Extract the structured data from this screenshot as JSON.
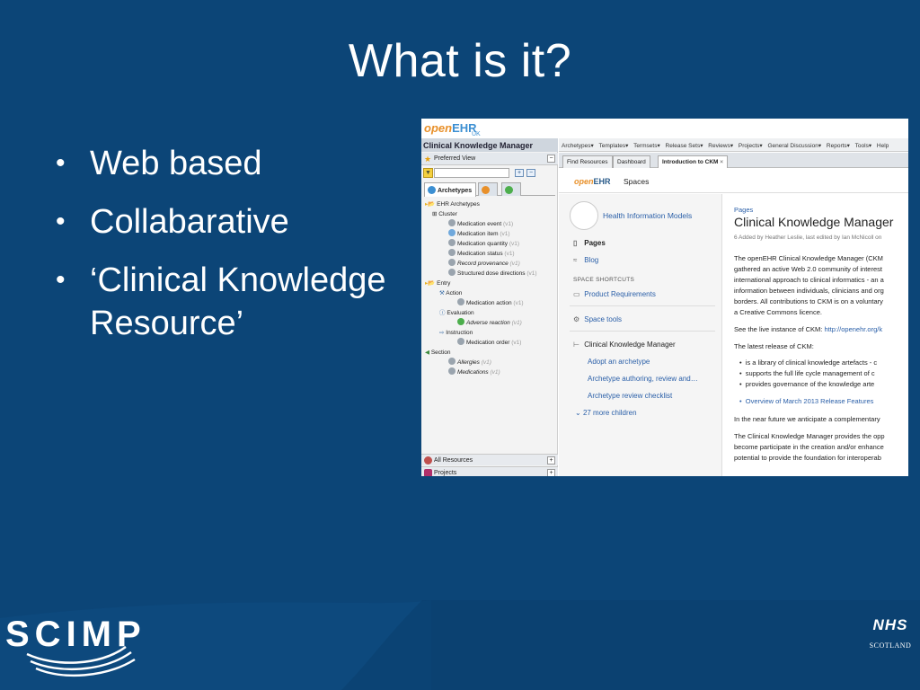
{
  "slide": {
    "title": "What is it?",
    "bullets": [
      "Web based",
      "Collabarative",
      "‘Clinical Knowledge",
      "Resource’"
    ],
    "bullet_glyph": "•"
  },
  "screenshot": {
    "logo": {
      "open": "open",
      "ehr": "EHR",
      "uk": "UK"
    },
    "left_panel": {
      "title": "Clinical Knowledge Manager",
      "preferred_view": "Preferred View",
      "tabs": [
        "Archetypes"
      ],
      "tree": {
        "root": "EHR Archetypes",
        "cluster": "Cluster",
        "cluster_items": [
          {
            "name": "Medication event",
            "ver": "(v1)",
            "italic": false
          },
          {
            "name": "Medication item",
            "ver": "(v1)",
            "italic": false
          },
          {
            "name": "Medication quantity",
            "ver": "(v1)",
            "italic": false
          },
          {
            "name": "Medication status",
            "ver": "(v1)",
            "italic": false
          },
          {
            "name": "Record provenance",
            "ver": "(v1)",
            "italic": true
          },
          {
            "name": "Structured dose directions",
            "ver": "(v1)",
            "italic": false
          }
        ],
        "entry": "Entry",
        "action": "Action",
        "medication_action": {
          "name": "Medication action",
          "ver": "(v1)"
        },
        "evaluation": "Evaluation",
        "adverse_reaction": {
          "name": "Adverse reaction",
          "ver": "(v1)"
        },
        "instruction": "Instruction",
        "medication_order": {
          "name": "Medication order",
          "ver": "(v1)"
        },
        "section": "Section",
        "allergies": {
          "name": "Allergies",
          "ver": "(v1)"
        },
        "medications": {
          "name": "Medications",
          "ver": "(v1)"
        }
      },
      "bottom": [
        "All Resources",
        "Projects"
      ]
    },
    "menubar": [
      "Archetypes▾",
      "Templates▾",
      "Termsets▾",
      "Release Sets▾",
      "Reviews▾",
      "Projects▾",
      "General Discussion▾",
      "Reports▾",
      "Tools▾",
      "Help"
    ],
    "tabs": [
      "Find Resources",
      "Dashboard",
      "Introduction to CKM"
    ],
    "tab_close": "×",
    "confluence": {
      "logo_open": "open",
      "logo_ehr": "EHR",
      "spaces": "Spaces",
      "space_name": "Health Information Models",
      "nav": [
        {
          "icon": "📄",
          "label": "Pages",
          "bold": true
        },
        {
          "icon": "⤨",
          "label": "Blog",
          "bold": false
        }
      ],
      "shortcuts_heading": "SPACE SHORTCUTS",
      "product_requirements": "Product Requirements",
      "space_tools": "Space tools",
      "tree_root": "Clinical Knowledge Manager",
      "children": [
        "Adopt an archetype",
        "Archetype authoring, review and…",
        "Archetype review checklist"
      ],
      "more_children": "27 more children",
      "breadcrumb": "Pages",
      "page_title": "Clinical Knowledge Manager",
      "meta": "6  Added by Heather Leslie, last edited by Ian McNicoll on",
      "paragraphs": [
        "The openEHR Clinical Knowledge Manager (CKM",
        "gathered an active Web 2.0 community of interest",
        "international approach to clinical informatics - an a",
        "information between individuals, clinicians and org",
        "borders. All contributions to CKM is on a voluntary",
        "a Creative Commons licence."
      ],
      "see_live": "See the live instance of CKM: ",
      "see_live_link": "http://openehr.org/k",
      "latest": "The latest release of CKM:",
      "list_items": [
        "is a library of clinical knowledge artefacts - c",
        "supports the full life cycle management of c",
        "provides governance of the knowledge arte"
      ],
      "overview_link": "Overview of March 2013 Release Features",
      "near_future": "In the near future we anticipate a complementary",
      "ckm_provides": [
        "The Clinical Knowledge Manager provides the opp",
        "become participate in the creation and/or enhance",
        "potential to provide the foundation for interoperab"
      ]
    }
  },
  "footer": {
    "scimp": "SCIMP",
    "nhs": "NHS",
    "nhs_sub": "SCOTLAND"
  },
  "colors": {
    "background": "#0c4577",
    "accent_orange": "#e8902a",
    "link_blue": "#2a5fa8"
  }
}
